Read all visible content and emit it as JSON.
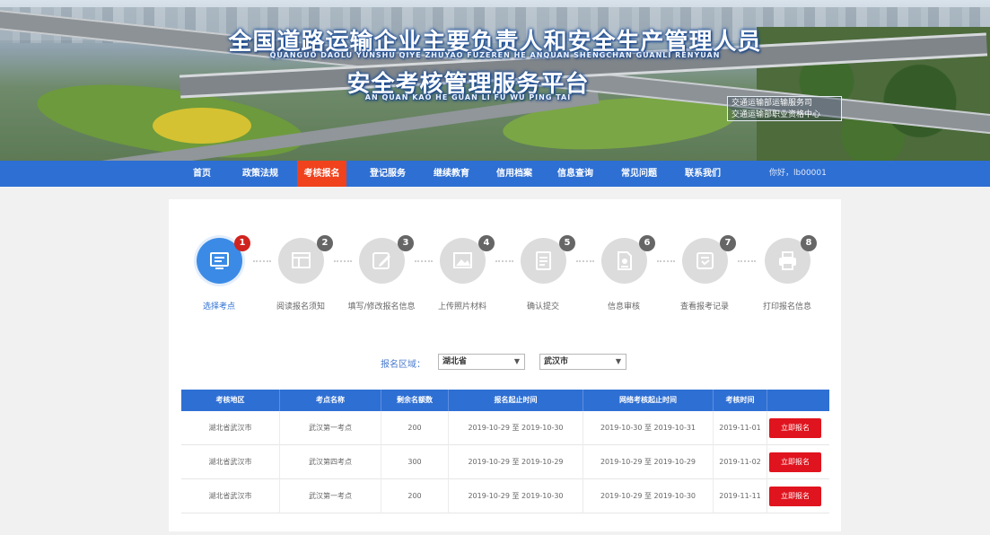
{
  "banner": {
    "title_line1": "全国道路运输企业主要负责人和安全生产管理人员",
    "pinyin_line1": "QUANGUO DAOLU YUNSHU QIYE ZHUYAO FUZEREN HE ANQUAN SHENGCHAN GUANLI RENYUAN",
    "title_line2": "安全考核管理服务平台",
    "pinyin_line2": "AN QUAN KAO HE GUAN LI FU WU PING TAI",
    "sponsor_line1": "交通运输部运输服务司",
    "sponsor_line2": "交通运输部职业资格中心"
  },
  "nav": {
    "items": [
      "首页",
      "政策法规",
      "考核报名",
      "登记服务",
      "继续教育",
      "信用档案",
      "信息查询",
      "常见问题",
      "联系我们"
    ],
    "active_index": 2,
    "user": "你好，lb00001"
  },
  "steps": [
    {
      "num": "1",
      "label": "选择考点",
      "icon": "monitor-icon"
    },
    {
      "num": "2",
      "label": "阅读报名须知",
      "icon": "document-icon"
    },
    {
      "num": "3",
      "label": "填写/修改报名信息",
      "icon": "edit-icon"
    },
    {
      "num": "4",
      "label": "上传照片材料",
      "icon": "image-icon"
    },
    {
      "num": "5",
      "label": "确认提交",
      "icon": "file-icon"
    },
    {
      "num": "6",
      "label": "信息审核",
      "icon": "audit-icon"
    },
    {
      "num": "7",
      "label": "查看报考记录",
      "icon": "record-icon"
    },
    {
      "num": "8",
      "label": "打印报名信息",
      "icon": "printer-icon"
    }
  ],
  "active_step": 0,
  "filter": {
    "label": "报名区域：",
    "province": "湖北省",
    "city": "武汉市"
  },
  "table": {
    "headers": [
      "考核地区",
      "考点名称",
      "剩余名额数",
      "报名起止时间",
      "网络考核起止时间",
      "考核时间",
      ""
    ],
    "rows": [
      {
        "region": "湖北省武汉市",
        "site": "武汉第一考点",
        "quota": "200",
        "signup": "2019-10-29 至 2019-10-30",
        "exam_window": "2019-10-30 至 2019-10-31",
        "exam_date": "2019-11-01",
        "action": "立即报名"
      },
      {
        "region": "湖北省武汉市",
        "site": "武汉第四考点",
        "quota": "300",
        "signup": "2019-10-29 至 2019-10-29",
        "exam_window": "2019-10-29 至 2019-10-29",
        "exam_date": "2019-11-02",
        "action": "立即报名"
      },
      {
        "region": "湖北省武汉市",
        "site": "武汉第一考点",
        "quota": "200",
        "signup": "2019-10-29 至 2019-10-30",
        "exam_window": "2019-10-29 至 2019-10-30",
        "exam_date": "2019-11-11",
        "action": "立即报名"
      }
    ]
  }
}
